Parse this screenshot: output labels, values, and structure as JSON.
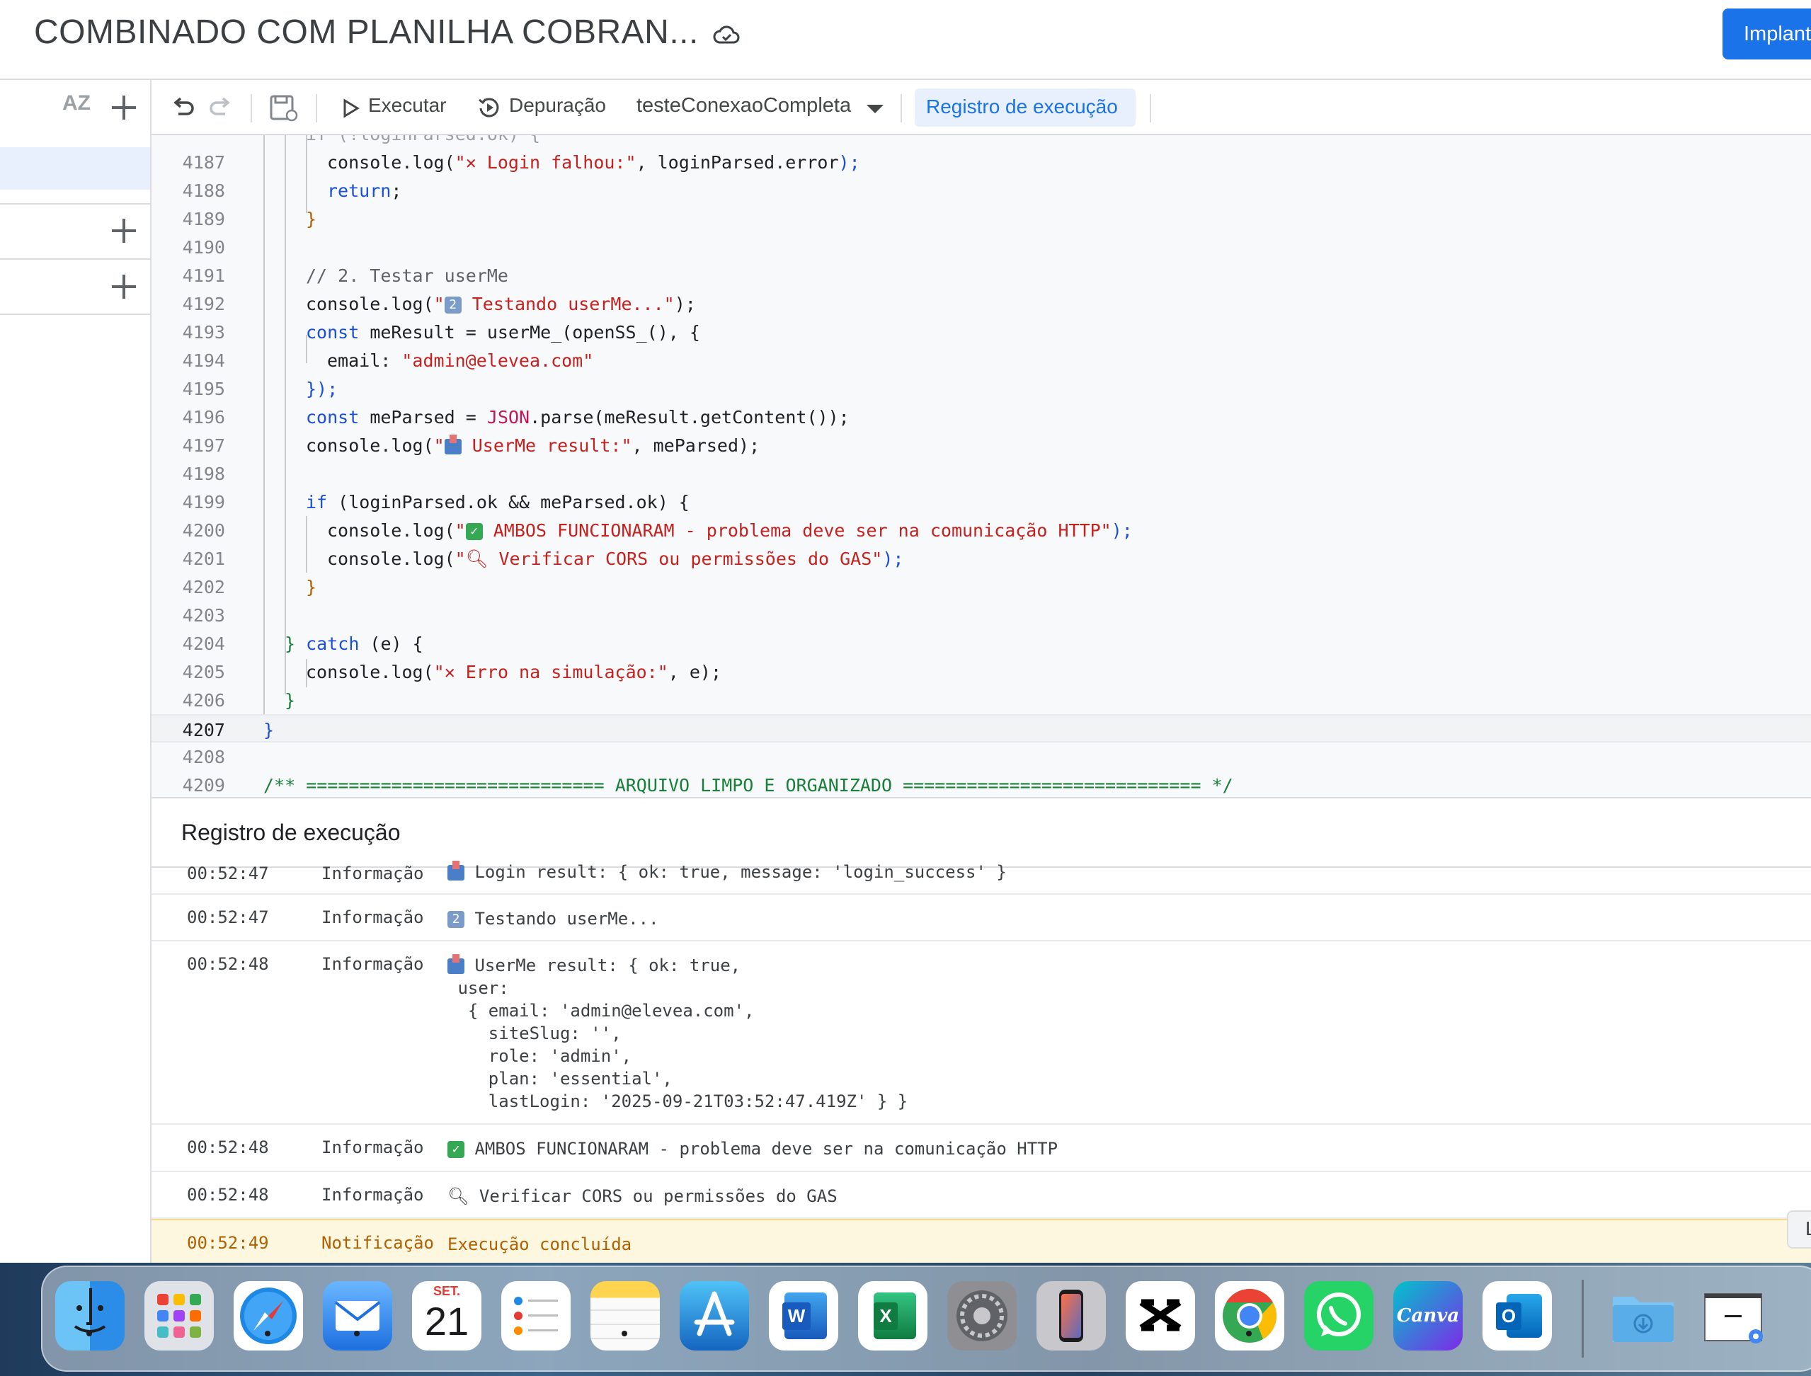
{
  "header": {
    "title": "COMBINADO COM PLANILHA COBRAN...",
    "deploy_label": "Implant"
  },
  "sidebar": {
    "sort_label": "AZ"
  },
  "toolbar": {
    "run_label": "Executar",
    "debug_label": "Depuração",
    "function_name": "testeConexaoCompleta",
    "log_label": "Registro de execução"
  },
  "editor": {
    "line_numbers": [
      "4187",
      "4188",
      "4189",
      "4190",
      "4191",
      "4192",
      "4193",
      "4194",
      "4195",
      "4196",
      "4197",
      "4198",
      "4199",
      "4200",
      "4201",
      "4202",
      "4203",
      "4204",
      "4205",
      "4206",
      "4207",
      "4208",
      "4209"
    ],
    "current_line": "4207",
    "code": {
      "l4187_a": "console.log(",
      "l4187_str": "\" Login falhou:\"",
      "l4187_b": ", loginParsed.error",
      "l4188": "return",
      "l4191": "// 2. Testar userMe",
      "l4192_a": "console.log(",
      "l4192_str": "\" Testando userMe...\"",
      "l4193_kw": "const",
      "l4193_b": " meResult = userMe_(openSS_(), {",
      "l4194_a": "email: ",
      "l4194_str": "\"admin@elevea.com\"",
      "l4195": "});",
      "l4196_kw": "const",
      "l4196_b": " meParsed = ",
      "l4196_js": "JSON",
      "l4196_c": ".parse(meResult.getContent());",
      "l4197_a": "console.log(",
      "l4197_str": "\" UserMe result:\"",
      "l4197_b": ", meParsed);",
      "l4199_kw": "if",
      "l4199_b": " (loginParsed.ok && meParsed.ok) {",
      "l4200_a": "console.log(",
      "l4200_str": "\" AMBOS FUNCIONARAM - problema deve ser na comunicação HTTP\"",
      "l4200_b": ");",
      "l4201_a": "console.log(",
      "l4201_str": "\" Verificar CORS ou permissões do GAS\"",
      "l4201_b": ");",
      "l4202": "}",
      "l4204_a": "} ",
      "l4204_kw": "catch",
      "l4204_b": " (e) {",
      "l4205_a": "console.log(",
      "l4205_str": "\" Erro na simulação:\"",
      "l4205_b": ", e);",
      "l4206": "}",
      "l4207": "}",
      "l4209": "/** ============================ ARQUIVO LIMPO E ORGANIZADO ============================ */"
    }
  },
  "log": {
    "title": "Registro de execução",
    "rows": [
      {
        "time": "00:52:47",
        "level": "Informação",
        "msg": "Login result: { ok: true, message: 'login_success' }"
      },
      {
        "time": "00:52:47",
        "level": "Informação",
        "msg": "Testando userMe..."
      },
      {
        "time": "00:52:48",
        "level": "Informação",
        "msg": "UserMe result: { ok: true,\n user:\n  { email: 'admin@elevea.com',\n    siteSlug: '',\n    role: 'admin',\n    plan: 'essential',\n    lastLogin: '2025-09-21T03:52:47.419Z' } }"
      },
      {
        "time": "00:52:48",
        "level": "Informação",
        "msg": "AMBOS FUNCIONARAM - problema deve ser na comunicação HTTP"
      },
      {
        "time": "00:52:48",
        "level": "Informação",
        "msg": "Verificar CORS ou permissões do GAS"
      },
      {
        "time": "00:52:49",
        "level": "Notificação",
        "msg": "Execução concluída"
      }
    ]
  },
  "dock": {
    "calendar_month": "SET.",
    "calendar_day": "21",
    "apps": [
      "Finder",
      "Launchpad",
      "Safari",
      "Mail",
      "Calendar",
      "Reminders",
      "Notes",
      "App Store",
      "Word",
      "Excel",
      "System Settings",
      "iPhone Mirroring",
      "CapCut",
      "Chrome",
      "WhatsApp",
      "Canva",
      "Outlook",
      "Downloads",
      "Preview"
    ],
    "word_letter": "W",
    "excel_letter": "X",
    "outlook_letter": "O",
    "canva_label": "Canva"
  },
  "floating": {
    "label": "L"
  }
}
